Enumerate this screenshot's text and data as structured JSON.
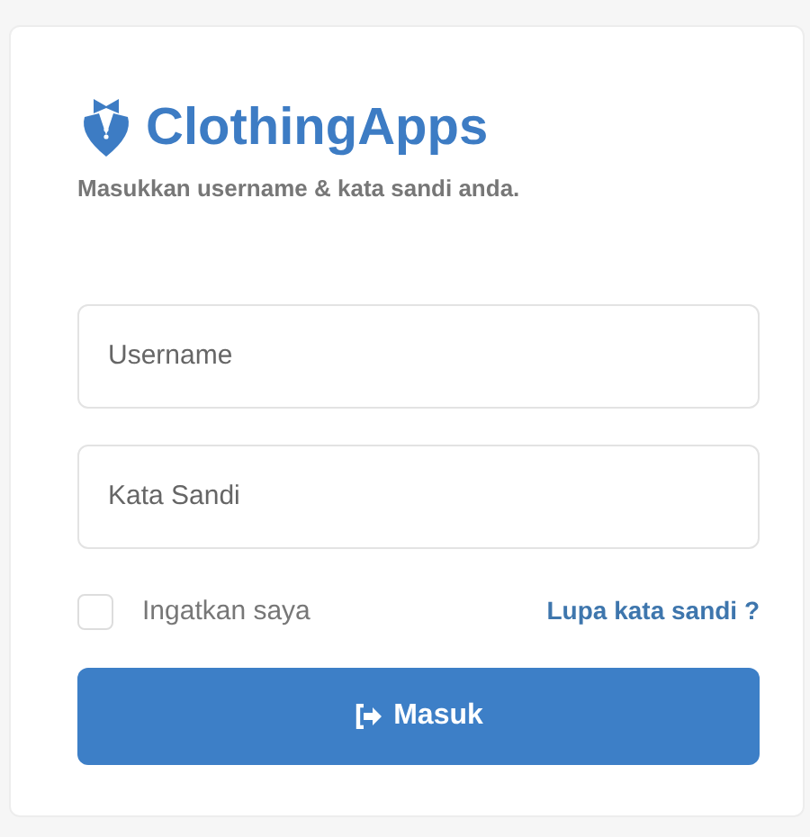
{
  "logo": {
    "name": "ClothingApps"
  },
  "subtitle": "Masukkan username & kata sandi anda.",
  "fields": [
    {
      "placeholder": "Username"
    },
    {
      "placeholder": "Kata Sandi"
    }
  ],
  "remember": {
    "label": "Ingatkan saya",
    "checked": false
  },
  "forgot_link": "Lupa kata sandi ?",
  "submit_button": "Masuk"
}
